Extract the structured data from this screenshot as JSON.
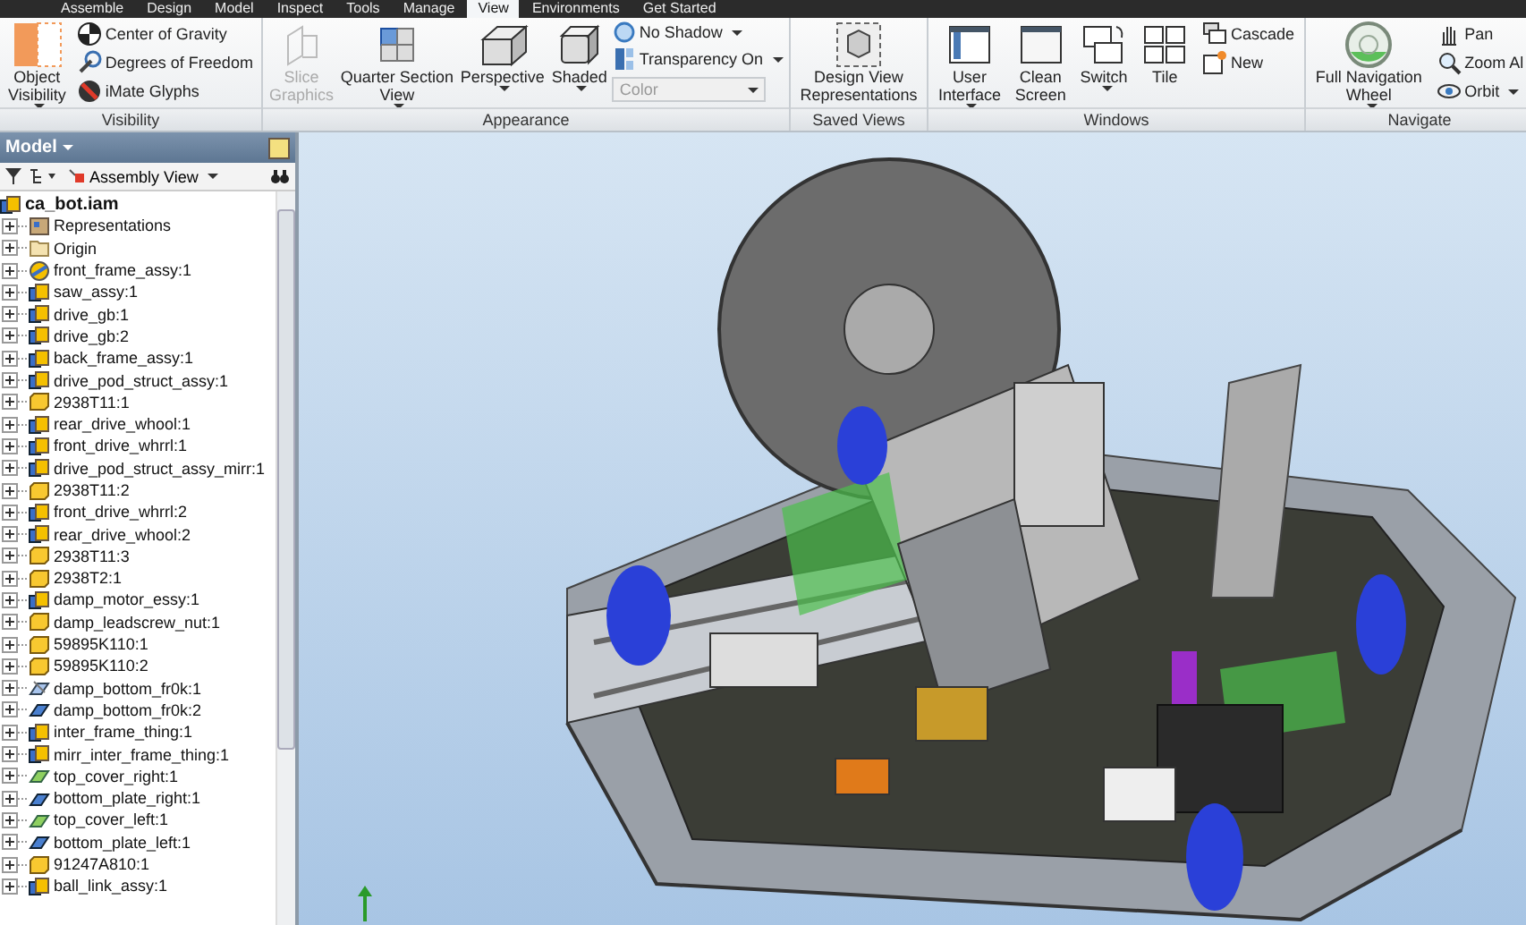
{
  "ribbon": {
    "tabs": [
      {
        "label": "Assemble",
        "selected": false
      },
      {
        "label": "Design",
        "selected": false
      },
      {
        "label": "Model",
        "selected": false
      },
      {
        "label": "Inspect",
        "selected": false
      },
      {
        "label": "Tools",
        "selected": false
      },
      {
        "label": "Manage",
        "selected": false
      },
      {
        "label": "View",
        "selected": true
      },
      {
        "label": "Environments",
        "selected": false
      },
      {
        "label": "Get Started",
        "selected": false
      }
    ],
    "groups": [
      {
        "title": "Visibility",
        "items": [
          {
            "kind": "large",
            "label": "Object\nVisibility",
            "dropdown": true,
            "disabled": false
          },
          {
            "kind": "stack",
            "items": [
              {
                "kind": "small",
                "label": "Center of Gravity",
                "dropdown": false
              },
              {
                "kind": "small",
                "label": "Degrees of Freedom",
                "dropdown": false
              },
              {
                "kind": "small",
                "label": "iMate Glyphs",
                "dropdown": false
              }
            ]
          }
        ]
      },
      {
        "title": "Appearance",
        "items": [
          {
            "kind": "large",
            "label": "Slice\nGraphics",
            "dropdown": false,
            "disabled": true
          },
          {
            "kind": "large",
            "label": "Quarter Section\nView",
            "dropdown": true,
            "disabled": false
          },
          {
            "kind": "large",
            "label": "Perspective",
            "dropdown": true,
            "disabled": false
          },
          {
            "kind": "large",
            "label": "Shaded",
            "dropdown": true,
            "disabled": false
          },
          {
            "kind": "stack",
            "items": [
              {
                "kind": "small",
                "label": "No Shadow",
                "dropdown": true
              },
              {
                "kind": "small",
                "label": "Transparency On",
                "dropdown": true
              },
              {
                "kind": "combo",
                "placeholder": "Color",
                "disabled": true
              }
            ]
          }
        ]
      },
      {
        "title": "Saved Views",
        "items": [
          {
            "kind": "large",
            "label": "Design View\nRepresentations",
            "dropdown": false,
            "disabled": false
          }
        ]
      },
      {
        "title": "Windows",
        "items": [
          {
            "kind": "large",
            "label": "User\nInterface",
            "dropdown": true,
            "disabled": false
          },
          {
            "kind": "large",
            "label": "Clean\nScreen",
            "dropdown": false,
            "disabled": false
          },
          {
            "kind": "large",
            "label": "Switch",
            "dropdown": true,
            "disabled": false
          },
          {
            "kind": "large",
            "label": "Tile",
            "dropdown": false,
            "disabled": false
          },
          {
            "kind": "stack",
            "items": [
              {
                "kind": "small",
                "label": "Cascade",
                "dropdown": false
              },
              {
                "kind": "small",
                "label": "New",
                "dropdown": false
              }
            ]
          }
        ]
      },
      {
        "title": "Navigate",
        "items": [
          {
            "kind": "large",
            "label": "Full Navigation\nWheel",
            "dropdown": true,
            "disabled": false
          },
          {
            "kind": "stack",
            "items": [
              {
                "kind": "small",
                "label": "Pan",
                "dropdown": false
              },
              {
                "kind": "small",
                "label": "Zoom Al",
                "dropdown": false
              },
              {
                "kind": "small",
                "label": "Orbit",
                "dropdown": true
              }
            ]
          }
        ]
      }
    ]
  },
  "browser": {
    "title": "Model",
    "view_selector": "Assembly View",
    "root": {
      "label": "ca_bot.iam",
      "kind": "assembly",
      "children": [
        {
          "label": "Representations",
          "kind": "representations",
          "expanded": false
        },
        {
          "label": "Origin",
          "kind": "folder",
          "expanded": false
        },
        {
          "label": "front_frame_assy:1",
          "kind": "flex-assembly",
          "expanded": false
        },
        {
          "label": "saw_assy:1",
          "kind": "assembly",
          "expanded": false
        },
        {
          "label": "drive_gb:1",
          "kind": "assembly",
          "expanded": false
        },
        {
          "label": "drive_gb:2",
          "kind": "assembly",
          "expanded": false
        },
        {
          "label": "back_frame_assy:1",
          "kind": "assembly",
          "expanded": false
        },
        {
          "label": "drive_pod_struct_assy:1",
          "kind": "assembly",
          "expanded": false
        },
        {
          "label": "2938T11:1",
          "kind": "part",
          "expanded": false
        },
        {
          "label": "rear_drive_whool:1",
          "kind": "assembly",
          "expanded": false
        },
        {
          "label": "front_drive_whrrl:1",
          "kind": "assembly",
          "expanded": false
        },
        {
          "label": "drive_pod_struct_assy_mirr:1",
          "kind": "assembly",
          "expanded": false
        },
        {
          "label": "2938T11:2",
          "kind": "part",
          "expanded": false
        },
        {
          "label": "front_drive_whrrl:2",
          "kind": "assembly",
          "expanded": false
        },
        {
          "label": "rear_drive_whool:2",
          "kind": "assembly",
          "expanded": false
        },
        {
          "label": "2938T11:3",
          "kind": "part",
          "expanded": false
        },
        {
          "label": "2938T2:1",
          "kind": "part",
          "expanded": false
        },
        {
          "label": "damp_motor_essy:1",
          "kind": "assembly",
          "expanded": false
        },
        {
          "label": "damp_leadscrew_nut:1",
          "kind": "part",
          "expanded": false
        },
        {
          "label": "59895K110:1",
          "kind": "part",
          "expanded": false
        },
        {
          "label": "59895K110:2",
          "kind": "part",
          "expanded": false
        },
        {
          "label": "damp_bottom_fr0k:1",
          "kind": "flex-sheet",
          "expanded": false
        },
        {
          "label": "damp_bottom_fr0k:2",
          "kind": "sheet",
          "expanded": false
        },
        {
          "label": "inter_frame_thing:1",
          "kind": "assembly",
          "expanded": false
        },
        {
          "label": "mirr_inter_frame_thing:1",
          "kind": "assembly",
          "expanded": false
        },
        {
          "label": "top_cover_right:1",
          "kind": "sheet-green",
          "expanded": false
        },
        {
          "label": "bottom_plate_right:1",
          "kind": "sheet",
          "expanded": false
        },
        {
          "label": "top_cover_left:1",
          "kind": "sheet-green",
          "expanded": false
        },
        {
          "label": "bottom_plate_left:1",
          "kind": "sheet",
          "expanded": false
        },
        {
          "label": "91247A810:1",
          "kind": "part",
          "expanded": false
        },
        {
          "label": "ball_link_assy:1",
          "kind": "assembly",
          "expanded": false
        }
      ]
    }
  }
}
